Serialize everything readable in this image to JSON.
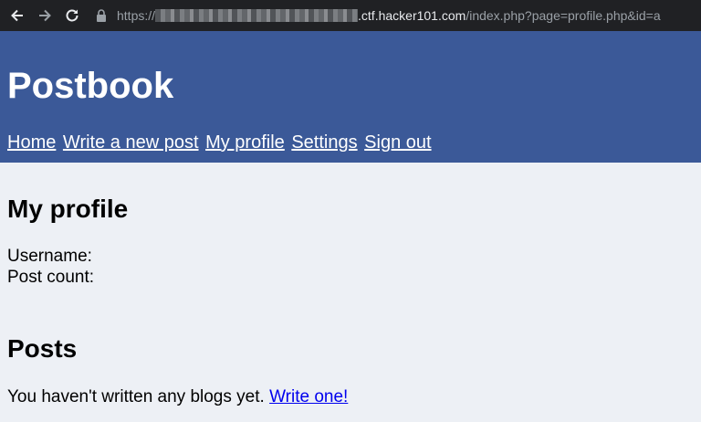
{
  "browser": {
    "url_scheme": "https://",
    "url_host": ".ctf.hacker101.com",
    "url_path": "/index.php?page=profile.php&id=a"
  },
  "header": {
    "title": "Postbook",
    "nav": [
      "Home",
      "Write a new post",
      "My profile",
      "Settings",
      "Sign out"
    ]
  },
  "profile": {
    "heading": "My profile",
    "username_label": "Username:",
    "post_count_label": "Post count:"
  },
  "posts": {
    "heading": "Posts",
    "empty_text": "You haven't written any blogs yet.",
    "write_link": "Write one!"
  },
  "colors": {
    "header_bg": "#3b5998",
    "page_bg": "#edf0f5",
    "link": "#0000ee"
  }
}
